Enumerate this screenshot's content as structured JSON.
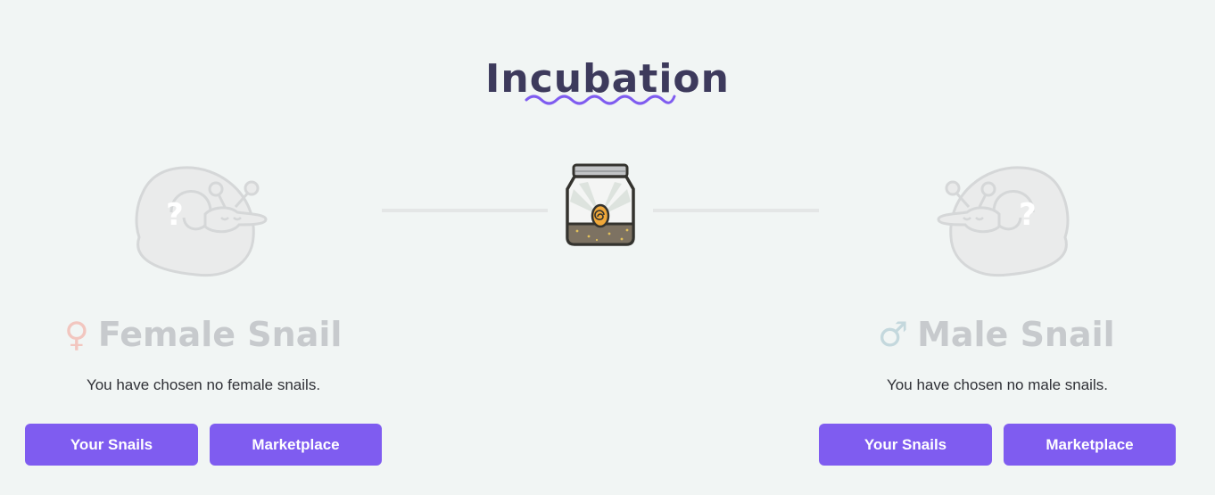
{
  "page": {
    "title": "Incubation"
  },
  "female": {
    "symbol": "♀",
    "title": "Female Snail",
    "empty_message": "You have chosen no female snails.",
    "your_snails_label": "Your Snails",
    "marketplace_label": "Marketplace"
  },
  "male": {
    "symbol": "♂",
    "title": "Male Snail",
    "empty_message": "You have chosen no male snails.",
    "your_snails_label": "Your Snails",
    "marketplace_label": "Marketplace"
  },
  "colors": {
    "background": "#f1f5f4",
    "title": "#3d3a5c",
    "accent": "#7f5cf0",
    "placeholder_gray": "#c7cacd",
    "female_symbol": "#f2c6bf",
    "male_symbol": "#c4d8dd"
  },
  "icons": {
    "title_decoration": "wave-icon",
    "incubator": "jar-icon",
    "female_placeholder": "snail-placeholder-icon",
    "male_placeholder": "snail-placeholder-icon"
  }
}
